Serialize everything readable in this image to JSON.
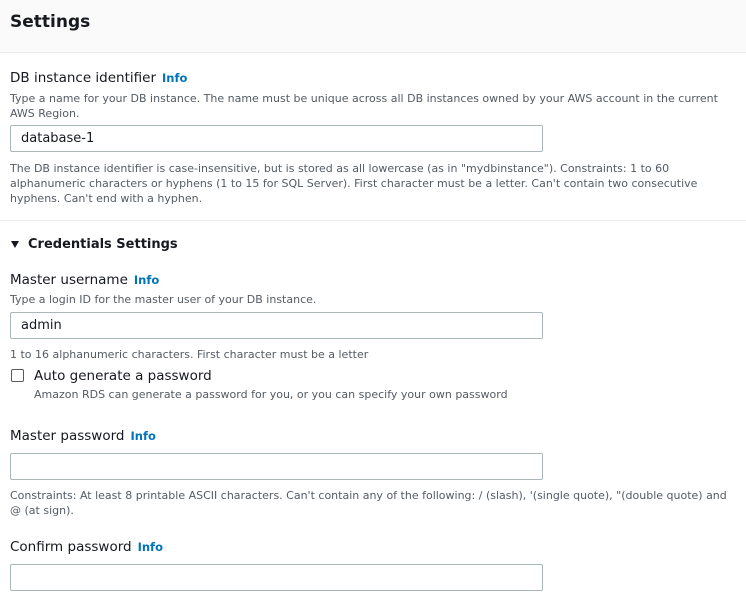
{
  "settings": {
    "title": "Settings",
    "db_identifier": {
      "label": "DB instance identifier",
      "info": "Info",
      "description": "Type a name for your DB instance. The name must be unique across all DB instances owned by your AWS account in the current AWS Region.",
      "value": "database-1",
      "constraint": "The DB instance identifier is case-insensitive, but is stored as all lowercase (as in \"mydbinstance\"). Constraints: 1 to 60 alphanumeric characters or hyphens (1 to 15 for SQL Server). First character must be a letter. Can't contain two consecutive hyphens. Can't end with a hyphen."
    },
    "credentials": {
      "title": "Credentials Settings",
      "master_username": {
        "label": "Master username",
        "info": "Info",
        "description": "Type a login ID for the master user of your DB instance.",
        "value": "admin",
        "constraint": "1 to 16 alphanumeric characters. First character must be a letter"
      },
      "auto_generate": {
        "label": "Auto generate a password",
        "description": "Amazon RDS can generate a password for you, or you can specify your own password",
        "checked": false
      },
      "master_password": {
        "label": "Master password",
        "info": "Info",
        "value": "",
        "constraint": "Constraints: At least 8 printable ASCII characters. Can't contain any of the following: / (slash), '(single quote), \"(double quote) and @ (at sign)."
      },
      "confirm_password": {
        "label": "Confirm password",
        "info": "Info",
        "value": ""
      }
    }
  }
}
